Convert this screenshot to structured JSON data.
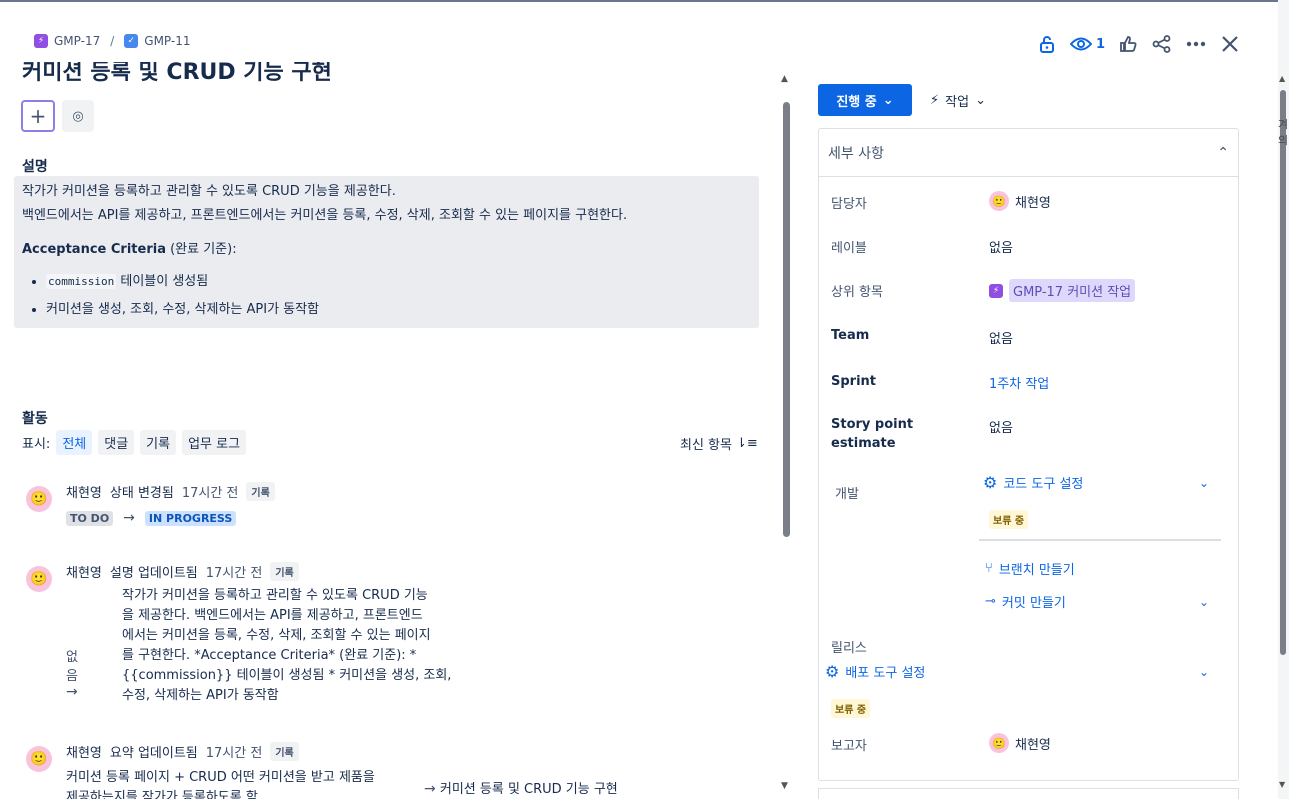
{
  "breadcrumb": [
    {
      "key": "GMP-17",
      "icon": "epic-icon"
    },
    {
      "key": "GMP-11",
      "icon": "task-checkbox-icon"
    }
  ],
  "breadcrumb_sep": "/",
  "header": {
    "watch_count": "1"
  },
  "issue": {
    "title": "커미션 등록 및 CRUD 기능 구현",
    "description_heading": "설명",
    "description_lines": [
      "작가가 커미션을 등록하고 관리할 수 있도록 CRUD 기능을 제공한다.",
      "백엔드에서는 API를 제공하고, 프론트엔드에서는 커미션을 등록, 수정, 삭제, 조회할 수 있는 페이지를 구현한다."
    ],
    "ac_bold": "Acceptance Criteria",
    "ac_rest": " (완료 기준):",
    "bullet1_code": "commission",
    "bullet1_rest": " 테이블이 생성됨",
    "bullet2": "커미션을 생성, 조회, 수정, 삭제하는 API가 동작함"
  },
  "activity": {
    "heading": "활동",
    "show_label": "표시:",
    "filters": [
      "전체",
      "댓글",
      "기록",
      "업무 로그"
    ],
    "sort_label": "최신 항목",
    "items": [
      {
        "user": "채현영",
        "action": "상태 변경됨",
        "time": "17시간 전",
        "tag": "기록",
        "from": "TO DO",
        "to": "IN PROGRESS"
      },
      {
        "user": "채현영",
        "action": "설명 업데이트됨",
        "time": "17시간 전",
        "tag": "기록",
        "from": "없음",
        "to_lines": [
          "작가가 커미션을 등록하고 관리할 수 있도록 CRUD 기능",
          "을 제공한다. 백엔드에서는 API를 제공하고, 프론트엔드",
          "에서는 커미션을 등록, 수정, 삭제, 조회할 수 있는 페이지",
          "를 구현한다. *Acceptance Criteria* (완료 기준): *",
          "{{commission}} 테이블이 생성됨 * 커미션을 생성, 조회,",
          "수정, 삭제하는 API가 동작함"
        ]
      },
      {
        "user": "채현영",
        "action": "요약 업데이트됨",
        "time": "17시간 전",
        "tag": "기록",
        "from_lines": [
          "커미션 등록 페이지 + CRUD 어떤 커미션을 받고 제품을",
          "제공하는지를 작가가 등록하도록 함"
        ],
        "to": "커미션 등록 및 CRUD 기능 구현"
      }
    ]
  },
  "sidebar": {
    "status_button": "진행 중",
    "action_button": "작업",
    "details_title": "세부 사항",
    "rows": {
      "assignee_label": "담당자",
      "assignee": "채현영",
      "labels_label": "레이블",
      "labels": "없음",
      "parent_label": "상위 항목",
      "parent": "GMP-17 커미션 작업",
      "team_label": "Team",
      "team": "없음",
      "sprint_label": "Sprint",
      "sprint": "1주차 작업",
      "sp_label_1": "Story point",
      "sp_label_2": "estimate",
      "sp": "없음",
      "dev_label": "개발",
      "code_tool": "코드 도구 설정",
      "pending": "보류 중",
      "branch": "브랜치 만들기",
      "commit": "커밋 만들기",
      "release_label": "릴리스",
      "deploy_tool": "배포 도구 설정",
      "pending2": "보류 중",
      "reporter_label": "보고자",
      "reporter": "채현영"
    }
  },
  "right_peek": "겨의"
}
